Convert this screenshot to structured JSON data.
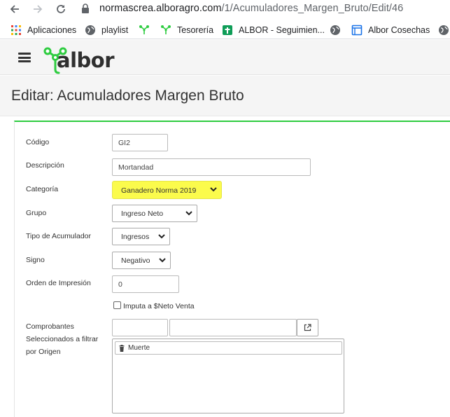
{
  "browser": {
    "url_host": "normascrea.alboragro.com",
    "url_path": "/1/Acumuladores_Margen_Bruto/Edit/46"
  },
  "bookmarks": [
    {
      "label": "Aplicaciones",
      "icon": "apps-grid-icon"
    },
    {
      "label": "playlist",
      "icon": "globe-icon"
    },
    {
      "label": "",
      "icon": "albor-icon"
    },
    {
      "label": "Tesorería",
      "icon": "albor-icon"
    },
    {
      "label": "ALBOR - Seguimien...",
      "icon": "sheets-icon"
    },
    {
      "label": "",
      "icon": "globe-icon"
    },
    {
      "label": "Albor Cosechas",
      "icon": "browser-icon"
    },
    {
      "label": "",
      "icon": "globe-icon"
    }
  ],
  "header": {
    "logo_text": "albor",
    "accent_color": "#2ecc40"
  },
  "page": {
    "title": "Editar: Acumuladores Margen Bruto"
  },
  "form": {
    "codigo": {
      "label": "Código",
      "value": "GI2"
    },
    "descripcion": {
      "label": "Descripción",
      "value": "Mortandad"
    },
    "categoria": {
      "label": "Categoría",
      "value": "Ganadero Norma 2019",
      "highlight_color": "#fbfb4c"
    },
    "grupo": {
      "label": "Grupo",
      "value": "Ingreso Neto"
    },
    "tipo": {
      "label": "Tipo de Acumulador",
      "value": "Ingresos"
    },
    "signo": {
      "label": "Signo",
      "value": "Negativo"
    },
    "orden": {
      "label": "Orden de Impresión",
      "value": "0"
    },
    "imputa": {
      "label": "Imputa a $Neto Venta",
      "checked": false
    },
    "comprobantes": {
      "label_line1": "Comprobantes",
      "label_line2": "Seleccionados a filtrar",
      "label_line3": "por Origen",
      "input1_value": "",
      "input2_value": "",
      "items": [
        "Muerte"
      ]
    }
  }
}
